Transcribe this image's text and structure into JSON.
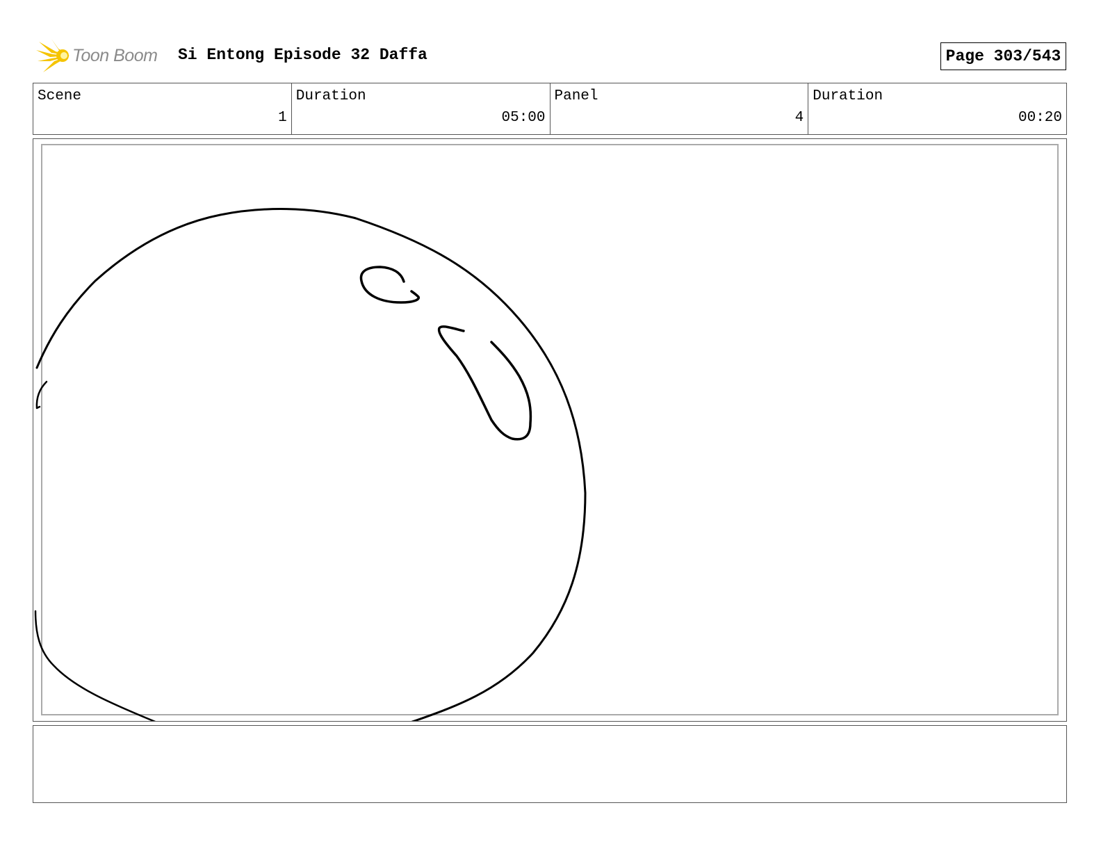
{
  "header": {
    "logo_text": "Toon Boom",
    "title": "Si Entong Episode 32 Daffa",
    "page_label": "Page 303/543"
  },
  "info": {
    "scene_label": "Scene",
    "scene_value": "1",
    "scene_duration_label": "Duration",
    "scene_duration_value": "05:00",
    "panel_label": "Panel",
    "panel_value": "4",
    "panel_duration_label": "Duration",
    "panel_duration_value": "00:20"
  },
  "colors": {
    "logo_flare": "#f5c400",
    "logo_text": "#8a8a8a",
    "frame_border": "#555555",
    "inner_frame_border": "#aaaaaa"
  },
  "notes": {
    "text": ""
  }
}
